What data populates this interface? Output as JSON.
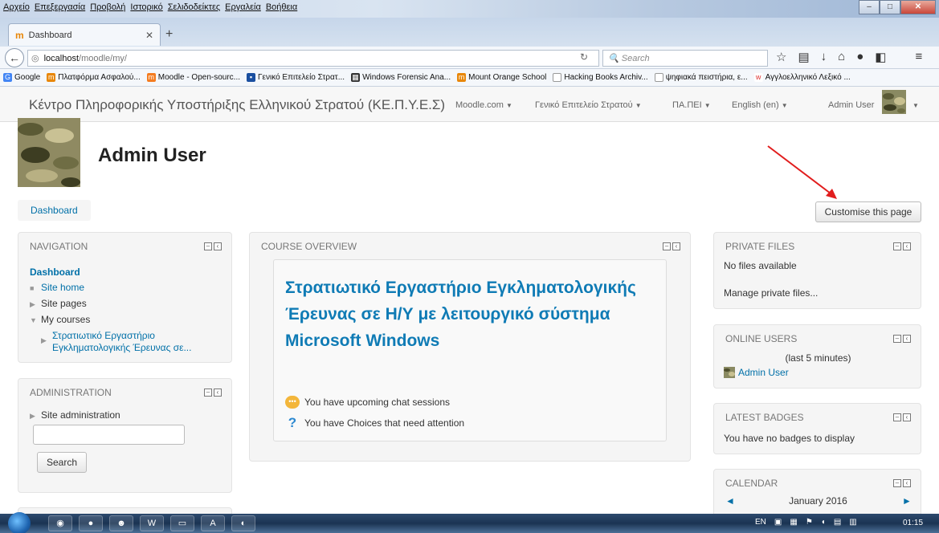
{
  "browser": {
    "menu": [
      "Αρχείο",
      "Επεξεργασία",
      "Προβολή",
      "Ιστορικό",
      "Σελιδοδείκτες",
      "Εργαλεία",
      "Βοήθεια"
    ],
    "tab_title": "Dashboard",
    "url_host": "localhost",
    "url_path": "/moodle/my/",
    "search_placeholder": "Search",
    "bookmarks": [
      "Google",
      "Πλατφόρμα Ασφαλού...",
      "Moodle - Open-sourc...",
      "Γενικό Επιτελείο Στρατ...",
      "Windows Forensic Ana...",
      "Mount Orange School",
      "Hacking Books Archiv...",
      "ψηφιακά πειστήρια, ε...",
      "Αγγλοελληνικό Λεξικό ..."
    ]
  },
  "moodle_nav": {
    "brand": "Κέντρο Πληροφορικής Υποστήριξης Ελληνικού Στρατού (ΚΕ.Π.Υ.Ε.Σ)",
    "items": [
      "Moodle.com",
      "Γενικό Επιτελείο Στρατού",
      "ΠΑ.ΠΕΙ",
      "English (en)"
    ],
    "user": "Admin User"
  },
  "page": {
    "heading": "Admin User",
    "breadcrumb": "Dashboard",
    "customise_button": "Customise this page"
  },
  "navigation": {
    "title": "NAVIGATION",
    "dashboard": "Dashboard",
    "site_home": "Site home",
    "site_pages": "Site pages",
    "my_courses": "My courses",
    "course_line1": "Στρατιωτικό Εργαστήριο",
    "course_line2": "Εγκληματολογικής Έρευνας σε..."
  },
  "administration": {
    "title": "ADMINISTRATION",
    "site_admin": "Site administration",
    "search_button": "Search"
  },
  "course_overview": {
    "title": "COURSE OVERVIEW",
    "course_title": "Στρατιωτικό Εργαστήριο Εγκληματολογικής Έρευνας σε Η/Υ με λειτουργικό σύστημα Microsoft Windows",
    "notice_chat": "You have upcoming chat sessions",
    "notice_choices": "You have Choices that need attention"
  },
  "private_files": {
    "title": "PRIVATE FILES",
    "empty": "No files available",
    "manage": "Manage private files..."
  },
  "online_users": {
    "title": "ONLINE USERS",
    "period": "(last 5 minutes)",
    "user": "Admin User"
  },
  "latest_badges": {
    "title": "LATEST BADGES",
    "empty": "You have no badges to display"
  },
  "calendar": {
    "title": "CALENDAR",
    "month": "January 2016"
  },
  "taskbar": {
    "lang": "EN",
    "time": "01:15"
  },
  "colors": {
    "link": "#0070a8",
    "course_title": "#0f7bb5",
    "arrow": "#e11d1d"
  }
}
